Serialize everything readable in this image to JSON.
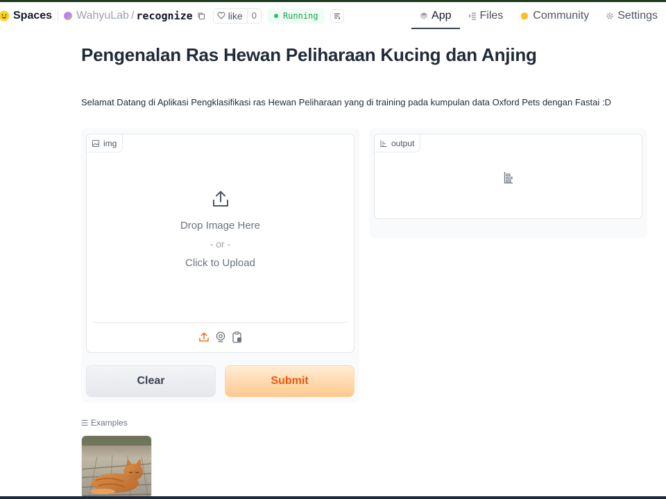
{
  "header": {
    "spaces_label": "Spaces",
    "owner": "WahyuLab",
    "separator": "/",
    "repo": "recognize",
    "like_label": "like",
    "like_count": "0",
    "status": "Running",
    "status_color": "#16a34a"
  },
  "nav": {
    "items": [
      {
        "label": "App",
        "icon": "cube-icon"
      },
      {
        "label": "Files",
        "icon": "files-icon"
      },
      {
        "label": "Community",
        "icon": "community-icon"
      },
      {
        "label": "Settings",
        "icon": "gear-icon"
      }
    ],
    "active": "App"
  },
  "main": {
    "title": "Pengenalan Ras Hewan Peliharaan Kucing dan Anjing",
    "description": "Selamat Datang di Aplikasi Pengklasifikasi ras Hewan Peliharaan yang di training pada kumpulan data Oxford Pets dengan Fastai :D"
  },
  "input": {
    "label": "img",
    "drop_text": "Drop Image Here",
    "or_text": "- or -",
    "click_text": "Click to Upload",
    "sources": [
      "upload-icon",
      "webcam-icon",
      "clipboard-icon"
    ],
    "accent": "#f97316"
  },
  "buttons": {
    "clear": "Clear",
    "submit": "Submit"
  },
  "output": {
    "label": "output"
  },
  "examples": {
    "label": "Examples",
    "items": [
      "cat-photo"
    ]
  }
}
